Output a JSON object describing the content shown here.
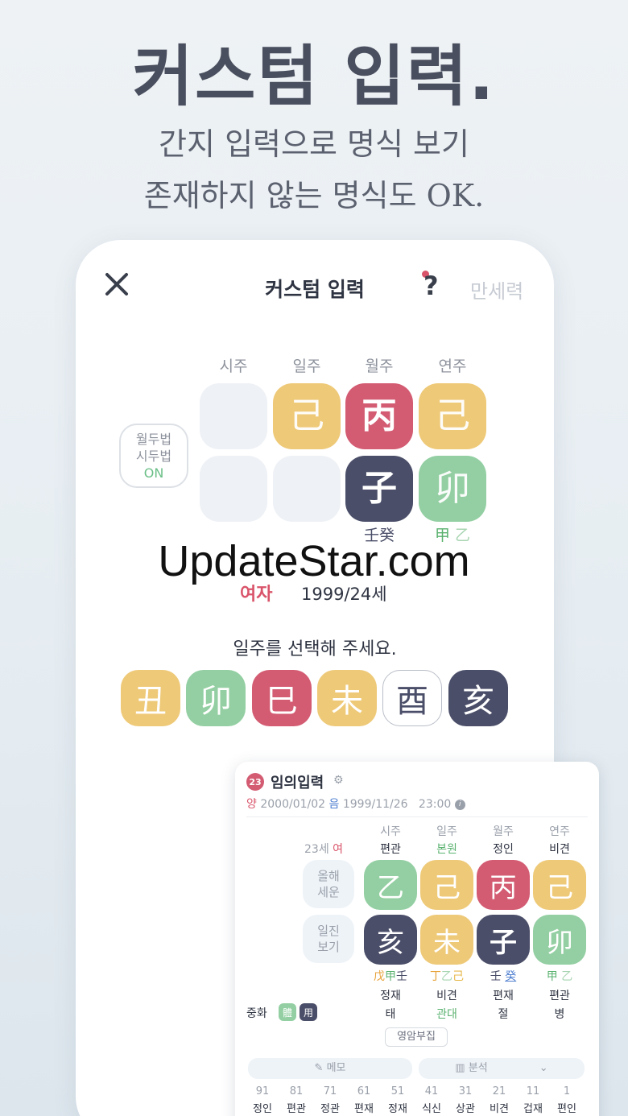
{
  "promo": {
    "title": "커스텀 입력.",
    "subtitle_line1": "간지 입력으로 명식 보기",
    "subtitle_line2": "존재하지 않는 명식도 OK."
  },
  "header": {
    "close_icon": "close-icon",
    "title": "커스텀 입력",
    "help": "?",
    "calendar": "만세력"
  },
  "pillars": {
    "labels": [
      "시주",
      "일주",
      "월주",
      "연주"
    ],
    "stems": [
      "",
      "己",
      "丙",
      "己"
    ],
    "branches": [
      "",
      "",
      "子",
      "卯"
    ],
    "hidden_month": [
      "壬",
      "癸"
    ],
    "hidden_year": [
      "甲",
      "乙"
    ]
  },
  "rule_toggle": {
    "line1": "월두법",
    "line2": "시두법",
    "state": "ON"
  },
  "watermark": "UpdateStar.com",
  "profile": {
    "gender": "여자",
    "birth": "1999/24세"
  },
  "prompt": "일주를 선택해 주세요.",
  "choices": [
    "丑",
    "卯",
    "巳",
    "未",
    "酉",
    "亥"
  ],
  "card": {
    "badge": "23",
    "title": "임의입력",
    "solar_prefix": "양",
    "solar_date": "2000/01/02",
    "lunar_prefix": "음",
    "lunar_date": "1999/11/26",
    "time": "23:00",
    "age": "23세",
    "gender": "여",
    "side_buttons": [
      [
        "올해",
        "세운"
      ],
      [
        "일진",
        "보기"
      ]
    ],
    "columns": [
      {
        "label": "시주",
        "god": "편관",
        "stem": "乙",
        "branch": "亥",
        "hidden": [
          "戊",
          "甲",
          "壬"
        ],
        "god2": "정재",
        "stage": "태"
      },
      {
        "label": "일주",
        "god": "본원",
        "stem": "己",
        "branch": "未",
        "hidden": [
          "丁",
          "乙",
          "己"
        ],
        "god2": "비견",
        "stage": "관대"
      },
      {
        "label": "월주",
        "god": "정인",
        "stem": "丙",
        "branch": "子",
        "hidden": [
          "壬",
          "癸"
        ],
        "god2": "편재",
        "stage": "절"
      },
      {
        "label": "연주",
        "god": "비견",
        "stem": "己",
        "branch": "卯",
        "hidden": [
          "甲",
          "乙"
        ],
        "god2": "편관",
        "stage": "병"
      }
    ],
    "balance_label": "중화",
    "balance_chips": [
      "體",
      "用"
    ],
    "yinyang_btn": "영암부집",
    "memo": "메모",
    "analysis": "분석",
    "luck_numbers": [
      "91",
      "81",
      "71",
      "61",
      "51",
      "41",
      "31",
      "21",
      "11",
      "1"
    ],
    "luck_gods": [
      "정인",
      "편관",
      "정관",
      "편재",
      "정재",
      "식신",
      "상관",
      "비견",
      "겁재",
      "편인"
    ]
  },
  "colors": {
    "yellow": "#eec978",
    "red": "#d35b72",
    "navy": "#4a4e68",
    "green": "#93cfa2",
    "accent_pink": "#d9546a"
  }
}
